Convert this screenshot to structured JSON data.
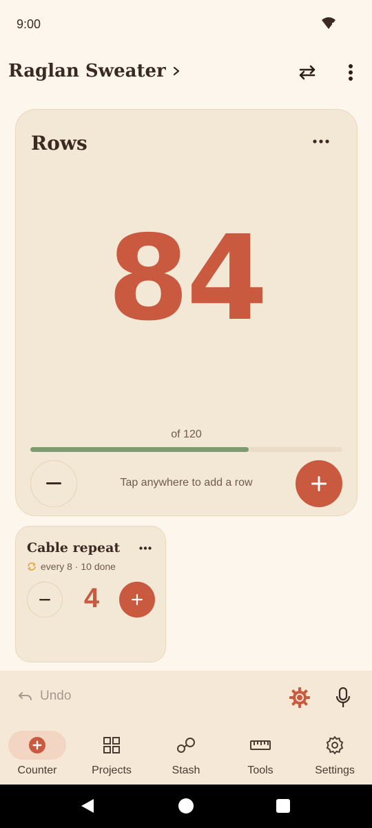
{
  "status": {
    "time": "9:00"
  },
  "project": {
    "title": "Raglan Sweater"
  },
  "main_counter": {
    "title": "Rows",
    "value": "84",
    "of_label": "of 120",
    "progress_fraction": 0.7,
    "hint": "Tap anywhere to add a row"
  },
  "secondary_counter": {
    "title": "Cable repeat",
    "meta": "every 8 · 10 done",
    "value": "4"
  },
  "actions": {
    "undo_label": "Undo"
  },
  "nav": {
    "items": [
      {
        "label": "Counter",
        "icon": "plus-circle-icon",
        "active": true
      },
      {
        "label": "Projects",
        "icon": "grid-icon",
        "active": false
      },
      {
        "label": "Stash",
        "icon": "yarn-icon",
        "active": false
      },
      {
        "label": "Tools",
        "icon": "ruler-icon",
        "active": false
      },
      {
        "label": "Settings",
        "icon": "gear-icon",
        "active": false
      }
    ]
  },
  "colors": {
    "accent": "#c95a3f",
    "progress": "#7d9a72",
    "background": "#fdf6ec",
    "card": "#f3e8d6"
  }
}
